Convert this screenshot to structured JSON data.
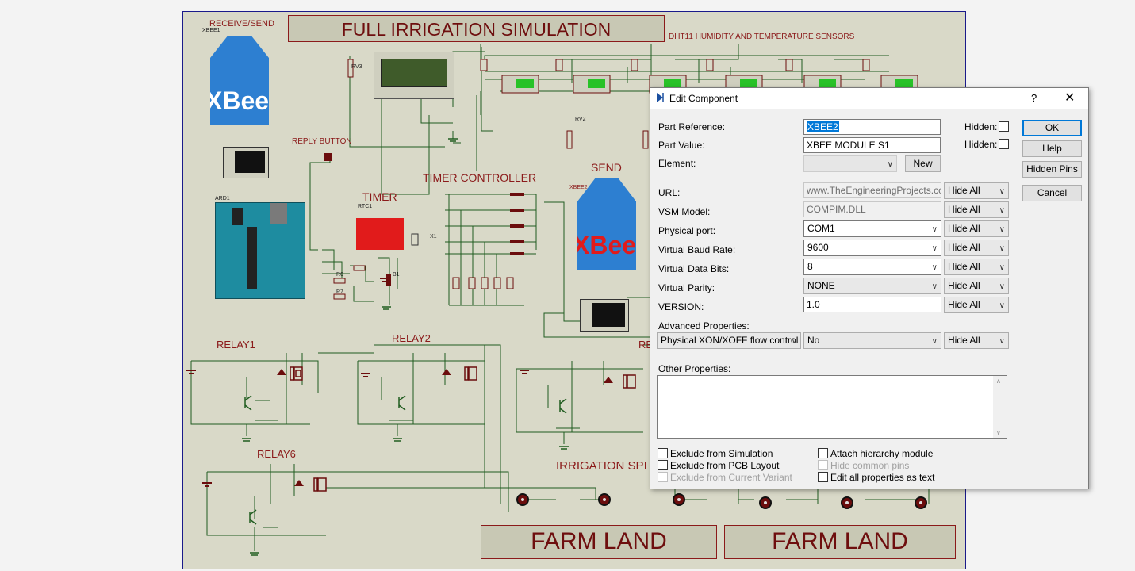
{
  "schematic": {
    "title": "FULL IRRIGATION SIMULATION",
    "labels": {
      "receive_send": "RECEIVE/SEND",
      "xbee1": "XBEE1",
      "xbee_brand": "XBee",
      "dht_title": "DHT11  HUMIDITY  AND  TEMPERATURE  SENSORS",
      "reply_button": "REPLY BUTTON",
      "timer_controller": "TIMER CONTROLLER",
      "timer": "TIMER",
      "send": "SEND",
      "xbee2": "XBEE2",
      "ard1": "ARD1",
      "rtc1": "RTC1",
      "relay1": "RELAY1",
      "relay2": "RELAY2",
      "relay3": "RE",
      "relay6": "RELAY6",
      "irrigation": "IRRIGATION SPI",
      "rv2": "RV2",
      "rv3": "RV3",
      "x1": "X1",
      "b1": "B1",
      "r6": "R6",
      "r7": "R7"
    },
    "farm_land_1": "FARM LAND",
    "farm_land_2": "FARM LAND"
  },
  "dialog": {
    "title": "Edit Component",
    "help_glyph": "?",
    "close_glyph": "✕",
    "part_reference_label": "Part Reference:",
    "part_reference_value": "XBEE2",
    "part_value_label": "Part Value:",
    "part_value_value": "XBEE MODULE S1",
    "element_label": "Element:",
    "element_value": "",
    "hidden_label_1": "Hidden:",
    "hidden_label_2": "Hidden:",
    "new_button": "New",
    "ok_button": "OK",
    "help_button": "Help",
    "hidden_pins_button": "Hidden Pins",
    "cancel_button": "Cancel",
    "properties": [
      {
        "label": "URL:",
        "value": "www.TheEngineeringProjects.com",
        "kind": "disabled",
        "visibility": "Hide All"
      },
      {
        "label": "VSM Model:",
        "value": "COMPIM.DLL",
        "kind": "disabled",
        "visibility": "Hide All"
      },
      {
        "label": "Physical port:",
        "value": "COM1",
        "kind": "combo",
        "visibility": "Hide All"
      },
      {
        "label": "Virtual Baud Rate:",
        "value": "9600",
        "kind": "combo",
        "visibility": "Hide All"
      },
      {
        "label": "Virtual Data Bits:",
        "value": "8",
        "kind": "combo",
        "visibility": "Hide All"
      },
      {
        "label": "Virtual Parity:",
        "value": "NONE",
        "kind": "combo-gray",
        "visibility": "Hide All"
      },
      {
        "label": "VERSION:",
        "value": "1.0",
        "kind": "text",
        "visibility": "Hide All"
      }
    ],
    "advanced_label": "Advanced Properties:",
    "advanced_property": "Physical XON/XOFF flow control",
    "advanced_value": "No",
    "advanced_visibility": "Hide All",
    "other_properties_label": "Other Properties:",
    "checkboxes": {
      "exclude_simulation": "Exclude from Simulation",
      "exclude_pcb": "Exclude from PCB Layout",
      "exclude_variant": "Exclude from Current Variant",
      "attach_hierarchy": "Attach hierarchy module",
      "hide_common_pins": "Hide common pins",
      "edit_all_text": "Edit all properties as text"
    }
  }
}
